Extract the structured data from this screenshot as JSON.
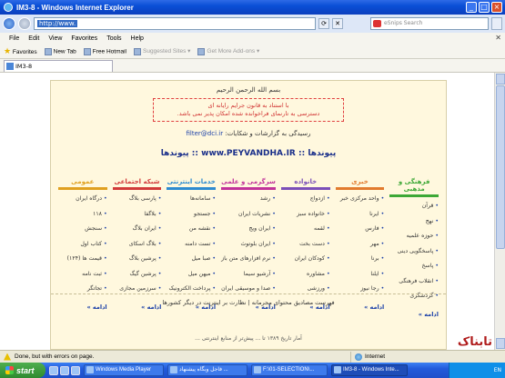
{
  "window": {
    "title": "IM3-8 - Windows Internet Explorer",
    "buttons": [
      "_",
      "□",
      "×"
    ]
  },
  "address_bar": {
    "url": "http://www.",
    "search_placeholder": "eSnips Search"
  },
  "menu": {
    "items": [
      "File",
      "Edit",
      "View",
      "Favorites",
      "Tools",
      "Help"
    ]
  },
  "favorites_bar": {
    "favorites_label": "Favorites",
    "items": [
      "New Tab",
      "Free Hotmail",
      "Suggested Sites ▾",
      "Get More Add-ons ▾"
    ]
  },
  "tab": {
    "label": "IM3-8"
  },
  "page": {
    "bismillah": "بسم الله الرحمن الرحيم",
    "warning_line1": "با استناد به قانون جرایم رایانه ای",
    "warning_line2": "دسترسی به تارنمای فراخوانده شده امکان پذیر نمی باشد.",
    "report_text": "رسیدگی به گزارشات و شکایات:",
    "report_email": "filter@dci.ir",
    "links_title": "پیوندها ::",
    "links_site": "www.PEYVANDHA.IR",
    "links_title_end": ":: پیوندها",
    "categories": [
      {
        "title": "فرهنگی و مذهبی",
        "color": "#3DA836",
        "items": [
          "قرآن",
          "نهج",
          "حوزه علمیه",
          "پاسخگویی دینی",
          "پاسخ",
          "انقلاب فرهنگی",
          "گردشگری"
        ]
      },
      {
        "title": "خبری",
        "color": "#E27B2E",
        "items": [
          "واحد مرکزی خبر",
          "ایرنا",
          "فارس",
          "مهر",
          "برنا",
          "ایلنا",
          "رجا نیوز"
        ]
      },
      {
        "title": "خانواده",
        "color": "#7B4FB8",
        "items": [
          "ازدواج",
          "خانواده سبز",
          "لقمه",
          "دست بخت",
          "کودکان ایران",
          "مشاوره",
          "ورزشی"
        ]
      },
      {
        "title": "سرگرمی و علمی",
        "color": "#C2339A",
        "items": [
          "رشد",
          "نشریات ایران",
          "ایران ویج",
          "ایران بلوتوث",
          "نرم افزارهای متن باز",
          "آرشیو سیما",
          "صدا و موسیقی ایران"
        ]
      },
      {
        "title": "خدمات اینترنتی",
        "color": "#2E8BD0",
        "items": [
          "سامانه‌ها",
          "جستجو",
          "نقشه من",
          "تست دامنه",
          "صبا میل",
          "میهن میل",
          "پرداخت الکترونیک"
        ]
      },
      {
        "title": "شبکه اجتماعی",
        "color": "#D23A3A",
        "items": [
          "پارسی بلاگ",
          "بلاگفا",
          "ایران بلاگ",
          "بلاگ اسکای",
          "پرشین بلاگ",
          "پرشین گیگ",
          "سرزمین مجازی"
        ]
      },
      {
        "title": "عمومی",
        "color": "#E0A020",
        "items": [
          "درگاه ایران",
          "۱۱۸",
          "سنجش",
          "کتاب اول",
          "قیمت ها (۱۲۴)",
          "ثبت نامه",
          "تجاتگر"
        ]
      }
    ],
    "more_label": "ادامه »",
    "bottom_links": "فهرست مصادیق محتوای مجرمانه | نظارت بر اینترنت در دیگر کشورها",
    "bottom_partial": "آمار تاریخ ۱۳۸۹ تا ... پیش‌تر از منابع اینترنتی ..."
  },
  "status": {
    "text": "Done, but with errors on page.",
    "zone": "Internet"
  },
  "taskbar": {
    "start": "start",
    "buttons": [
      "Windows Media Player",
      "فاجل وبگاه پیشنهاد ...",
      "F:\\01-SELECTION\\...",
      "IM3-8 - Windows Inte..."
    ],
    "tray_lang": "EN"
  },
  "watermark": "تابناک"
}
